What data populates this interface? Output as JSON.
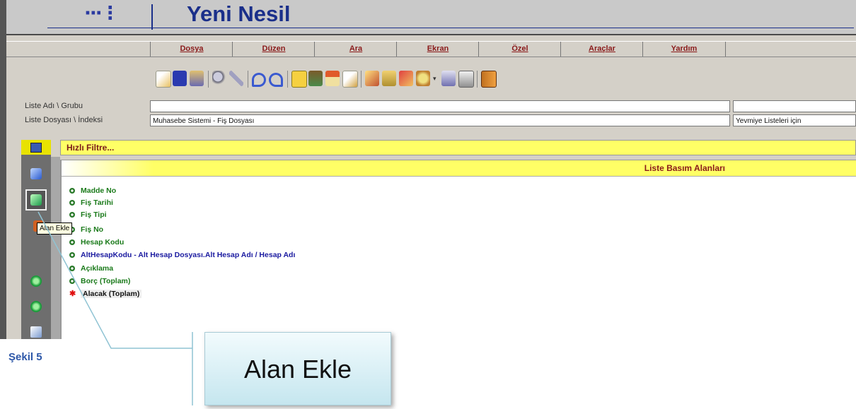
{
  "app": {
    "title": "Yeni Nesil",
    "logo_glyph": "···⋮"
  },
  "menu": [
    {
      "label": "Dosya"
    },
    {
      "label": "Düzen"
    },
    {
      "label": "Ara"
    },
    {
      "label": "Ekran"
    },
    {
      "label": "Özel"
    },
    {
      "label": "Araçlar"
    },
    {
      "label": "Yardım"
    }
  ],
  "toolbar_icons": [
    "new-icon",
    "save-icon",
    "print-icon",
    "search-icon",
    "tools-icon",
    "undo-icon",
    "redo-icon",
    "add-icon",
    "user-icon",
    "home-icon",
    "edit-icon",
    "note-icon",
    "folder-icon",
    "export-icon",
    "settings-icon",
    "print-preview-icon",
    "printer-icon",
    "exit-icon"
  ],
  "form": {
    "list_name_label": "Liste Adı \\ Grubu",
    "list_name_value": "",
    "list_group_value": "",
    "list_file_label": "Liste Dosyası \\ İndeksi",
    "list_file_value": "Muhasebe Sistemi - Fiş Dosyası",
    "list_index_value": "Yevmiye Listeleri için"
  },
  "filter": {
    "label": "Hızlı Filtre..."
  },
  "panel": {
    "title": "Liste Basım Alanları"
  },
  "fields": [
    {
      "label": "Madde No",
      "color": "#1a7a1a"
    },
    {
      "label": "Fiş Tarihi",
      "color": "#1a7a1a"
    },
    {
      "label": "Fiş Tipi",
      "color": "#1a7a1a"
    },
    {
      "label": "Fiş No",
      "color": "#1a7a1a"
    },
    {
      "label": "Hesap Kodu",
      "color": "#1a7a1a"
    },
    {
      "label": "AltHesapKodu - Alt Hesap Dosyası.Alt Hesap Adı / Hesap Adı",
      "color": "#1a1aa0"
    },
    {
      "label": "Açıklama",
      "color": "#1a7a1a"
    },
    {
      "label": "Borç  (Toplam)",
      "color": "#1a7a1a"
    },
    {
      "label": "Alacak  (Toplam)",
      "color": "#111111"
    }
  ],
  "tooltip": {
    "text": "Alan Ekle"
  },
  "callout": {
    "text": "Alan Ekle"
  },
  "caption": {
    "text": "Şekil 5"
  },
  "colors": {
    "title_blue": "#1a2f8a",
    "menu_red": "#8a1a1a",
    "highlight_yellow": "#ffff66",
    "caption_blue": "#2d57a8"
  }
}
